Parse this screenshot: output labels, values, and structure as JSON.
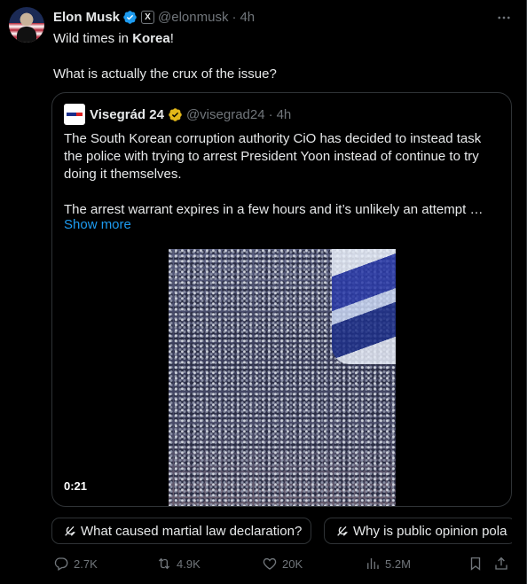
{
  "tweet": {
    "author_name": "Elon Musk",
    "handle": "@elonmusk",
    "separator": "·",
    "time": "4h",
    "affiliate_badge": "X",
    "text_line1_pre": "Wild times in ",
    "text_line1_bold": "Korea",
    "text_line1_post": "!",
    "text_line2": "What is actually the crux of the issue?"
  },
  "quote": {
    "author_name": "Visegrád 24",
    "handle": "@visegrad24",
    "separator": "·",
    "time": "4h",
    "lines": [
      "The South Korean corruption authority CiO has decided to instead task",
      "the police with trying to arrest President Yoon instead of continue to try",
      "doing it themselves."
    ],
    "line4": "The arrest warrant expires in a few hours and it’s unlikely an attempt …",
    "show_more": "Show more",
    "video_duration": "0:21"
  },
  "chips": [
    {
      "label": "What caused martial law declaration?",
      "icon": "grok-icon"
    },
    {
      "label": "Why is public opinion pola",
      "icon": "grok-icon"
    }
  ],
  "actions": {
    "replies": "2.7K",
    "reposts": "4.9K",
    "likes": "20K",
    "views": "5.2M"
  },
  "colors": {
    "background": "#000000",
    "text": "#e7e9ea",
    "muted": "#71767b",
    "link": "#1d9bf0",
    "border": "#2f3336",
    "verified_blue": "#1d9bf0",
    "verified_gold": "#e2b719"
  }
}
